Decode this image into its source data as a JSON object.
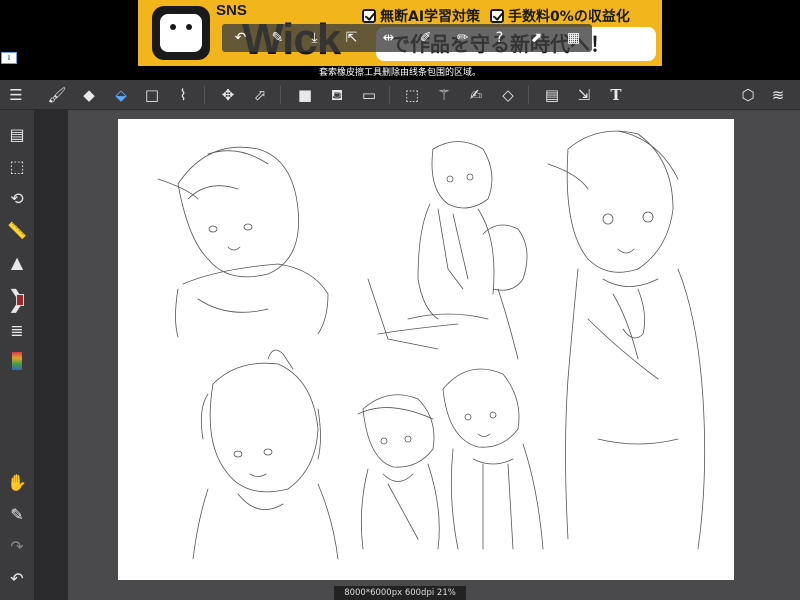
{
  "ad": {
    "sns": "SNS",
    "brand": "Wick",
    "tags": [
      "無断AI学習対策",
      "手数料0%の収益化"
    ],
    "slogan": "で作品を守る新時代へ！"
  },
  "hint": "套索橡皮擦工具删除由线条包围的区域。",
  "toolbar": {
    "icons": [
      "menu-icon",
      "brush-icon",
      "eraser-icon",
      "lasso-eraser-icon",
      "rect-shape-icon",
      "line-icon",
      "move-icon",
      "transform-icon",
      "fill-color-icon",
      "bucket-icon",
      "gradient-icon",
      "select-rect-icon",
      "magic-wand-icon",
      "select-pen-icon",
      "select-eraser-icon",
      "layout-icon",
      "select-move-icon",
      "text-icon",
      "3d-icon",
      "layers-icon"
    ]
  },
  "status": "8000*6000px 600dpi 21%",
  "colors": {
    "accent": "#5aa8ff",
    "bg": "#3b3b3d",
    "ad": "#f2b51b"
  }
}
